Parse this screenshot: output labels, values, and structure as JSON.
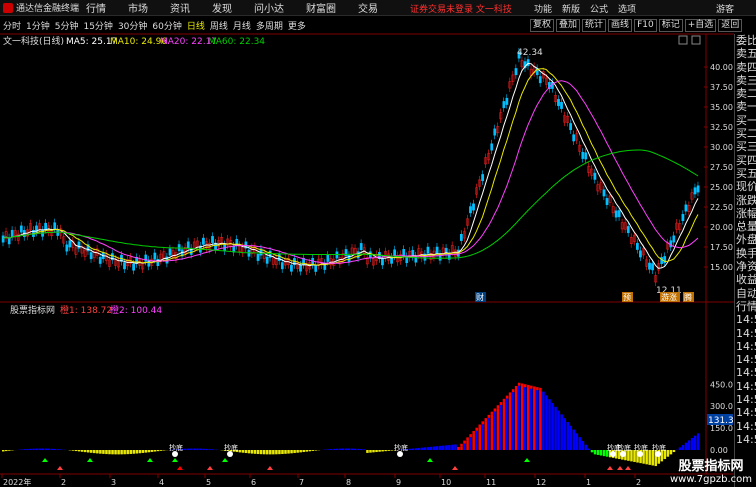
{
  "app": {
    "brand": "通达信金融终端",
    "guest": "游客",
    "notice": "证券交易未登录   文一科技"
  },
  "menu": [
    "行情",
    "市场",
    "资讯",
    "发现",
    "问小达",
    "财富圈",
    "交易"
  ],
  "sys_menu": [
    "功能",
    "新版",
    "公式",
    "选项"
  ],
  "periods": [
    "分时",
    "1分钟",
    "5分钟",
    "15分钟",
    "30分钟",
    "60分钟",
    "日线",
    "周线",
    "月线",
    "多周期",
    "更多"
  ],
  "active_period": "日线",
  "toolbar": [
    "复权",
    "叠加",
    "统计",
    "画线",
    "F10",
    "标记",
    "+自选",
    "返回"
  ],
  "main_chart": {
    "title": "文一科技(日线)",
    "ma_labels": [
      {
        "text": "MA5: 25.17",
        "color": "#ffffff"
      },
      {
        "text": "MA10: 24.96",
        "color": "#e8e800"
      },
      {
        "text": "MA20: 22.17",
        "color": "#ff40ff"
      },
      {
        "text": "MA60: 22.34",
        "color": "#00cc00"
      }
    ],
    "price_ticks": [
      "40.00",
      "37.50",
      "35.00",
      "32.50",
      "30.00",
      "27.50",
      "25.00",
      "22.50",
      "20.00",
      "17.50",
      "15.00"
    ],
    "high_label": "42.34",
    "low_label": "12.11",
    "event_labels": [
      "财",
      "预",
      "游涨",
      "腾"
    ]
  },
  "indicator": {
    "title": "股票指标网",
    "label1": "橙1: 138.72",
    "label2": "橙2: 100.44",
    "ticks": [
      "450.0",
      "300.0",
      "150.0",
      "0.00"
    ],
    "current_value": "131.33",
    "signal_texts": [
      "抄底",
      "抄底",
      "抄底",
      "抄底",
      "抄底",
      "抄底",
      "抄底"
    ]
  },
  "date_axis": [
    "2022年",
    "2",
    "3",
    "4",
    "5",
    "6",
    "7",
    "8",
    "9",
    "10",
    "11",
    "12",
    "1",
    "2"
  ],
  "right_panel": [
    "委比",
    "卖五",
    "卖四",
    "卖三",
    "卖二",
    "卖一",
    "买一",
    "买二",
    "买三",
    "买四",
    "买五",
    "现价",
    "涨跌",
    "涨幅",
    "总量",
    "外盘",
    "换手",
    "净资",
    "收益",
    "自动",
    "行情",
    "14:5",
    "14:5",
    "14:5",
    "14:5",
    "14:5",
    "14:5",
    "14:5",
    "14:5",
    "14:5",
    "14:5"
  ],
  "watermark": {
    "line1": "股票指标网",
    "line2": "www.7gpzb.com"
  },
  "colors": {
    "up": "#ff2020",
    "down": "#00c0ff",
    "ma5": "#ffffff",
    "ma10": "#e8e800",
    "ma20": "#ff40ff",
    "ma60": "#00cc00"
  }
}
